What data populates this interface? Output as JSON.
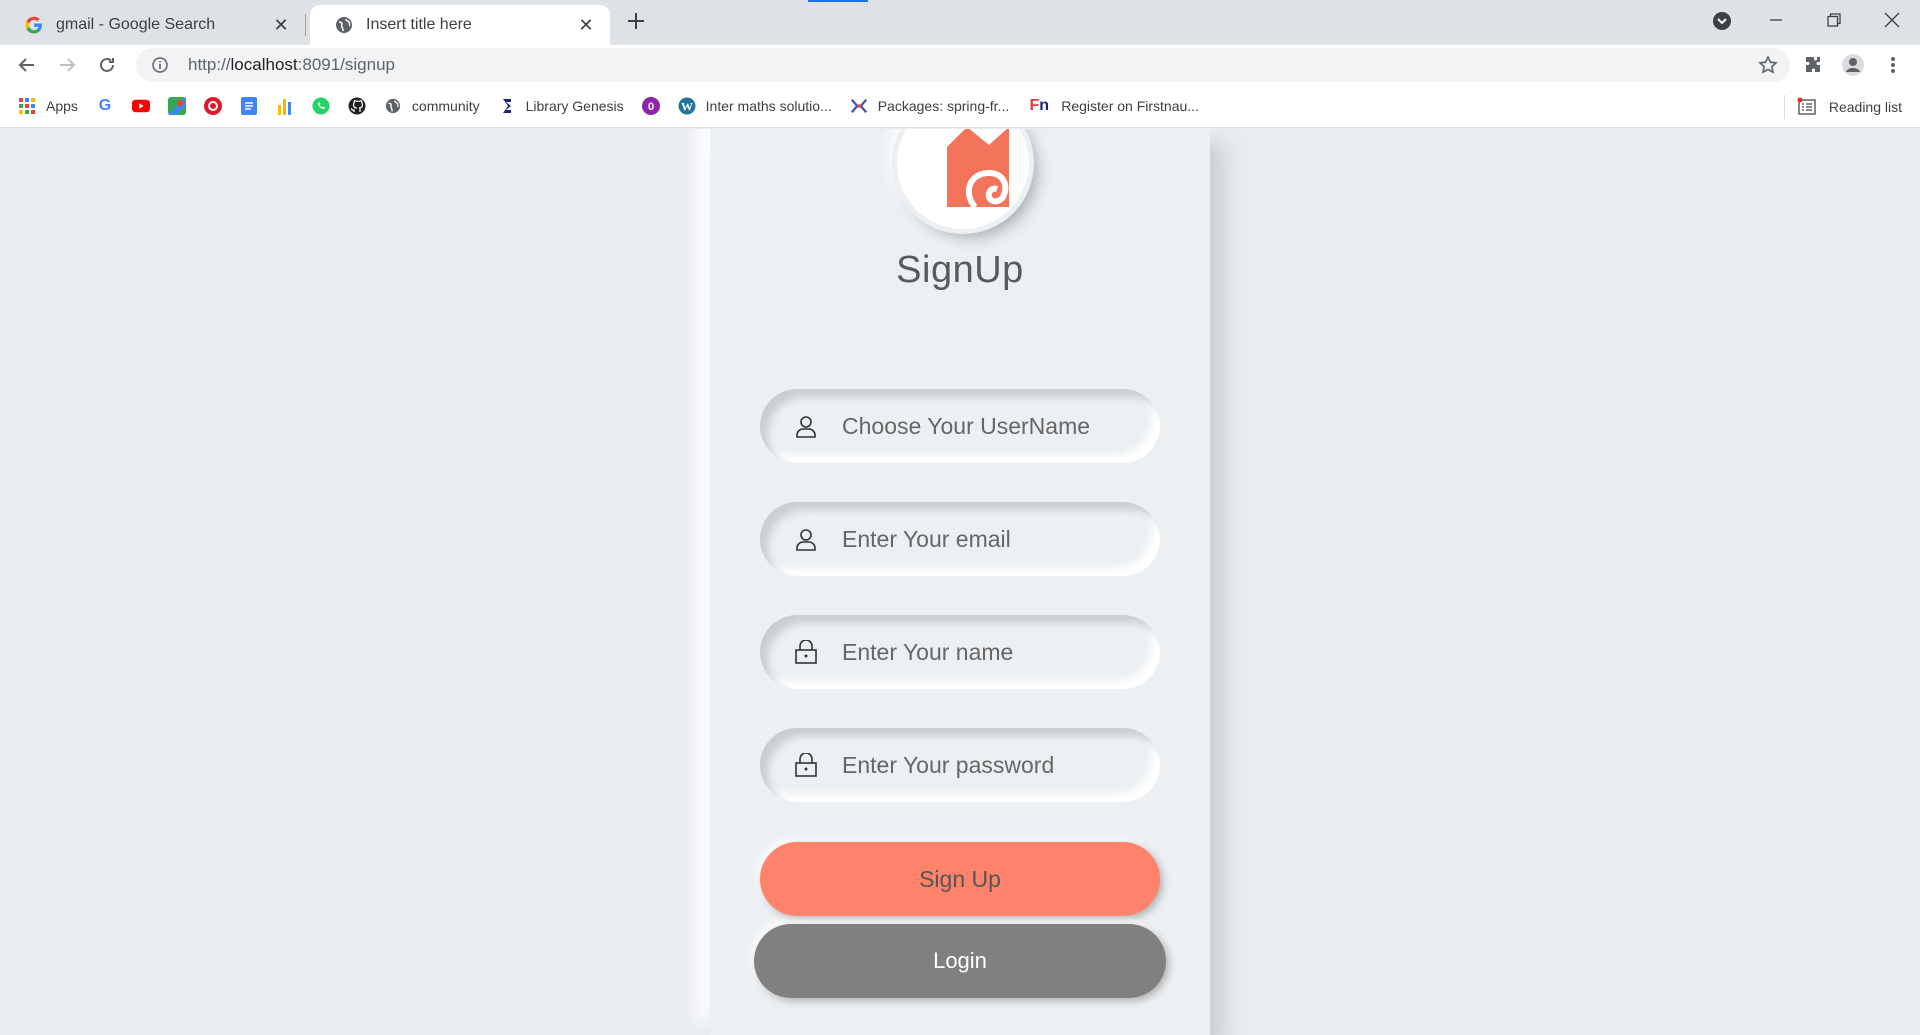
{
  "browser": {
    "tabs": [
      {
        "title": "gmail - Google Search",
        "favicon": "google-g-icon",
        "active": false
      },
      {
        "title": "Insert title here",
        "favicon": "globe-icon",
        "active": true
      }
    ],
    "address": {
      "url_prefix": "http://",
      "url_host": "localhost",
      "url_rest": ":8091/signup"
    },
    "bookmarks": [
      {
        "label": "Apps",
        "icon": "apps-grid-icon"
      },
      {
        "label": "",
        "icon": "google-icon"
      },
      {
        "label": "",
        "icon": "youtube-icon"
      },
      {
        "label": "",
        "icon": "maps-icon"
      },
      {
        "label": "",
        "icon": "red-circle-icon"
      },
      {
        "label": "",
        "icon": "docs-icon"
      },
      {
        "label": "",
        "icon": "analytics-icon"
      },
      {
        "label": "",
        "icon": "whatsapp-icon"
      },
      {
        "label": "",
        "icon": "github-icon"
      },
      {
        "label": "community",
        "icon": "globe-icon"
      },
      {
        "label": "Library Genesis",
        "icon": "library-icon"
      },
      {
        "label": "",
        "icon": "purple-badge-icon"
      },
      {
        "label": "Inter maths solutio...",
        "icon": "wordpress-icon"
      },
      {
        "label": "Packages: spring-fr...",
        "icon": "package-icon"
      },
      {
        "label": "Register on Firstnau...",
        "icon": "firstnaukri-icon"
      }
    ],
    "reading_list": "Reading list"
  },
  "signup": {
    "title": "SignUp",
    "fields": [
      {
        "placeholder": "Choose Your UserName",
        "icon": "user-icon"
      },
      {
        "placeholder": "Enter Your email",
        "icon": "user-icon"
      },
      {
        "placeholder": "Enter Your name",
        "icon": "lock-icon"
      },
      {
        "placeholder": "Enter Your password",
        "icon": "lock-icon"
      }
    ],
    "signup_button": "Sign Up",
    "login_button": "Login"
  },
  "colors": {
    "accent": "#ff826a",
    "login": "#808080",
    "background": "#ecf0f3"
  }
}
